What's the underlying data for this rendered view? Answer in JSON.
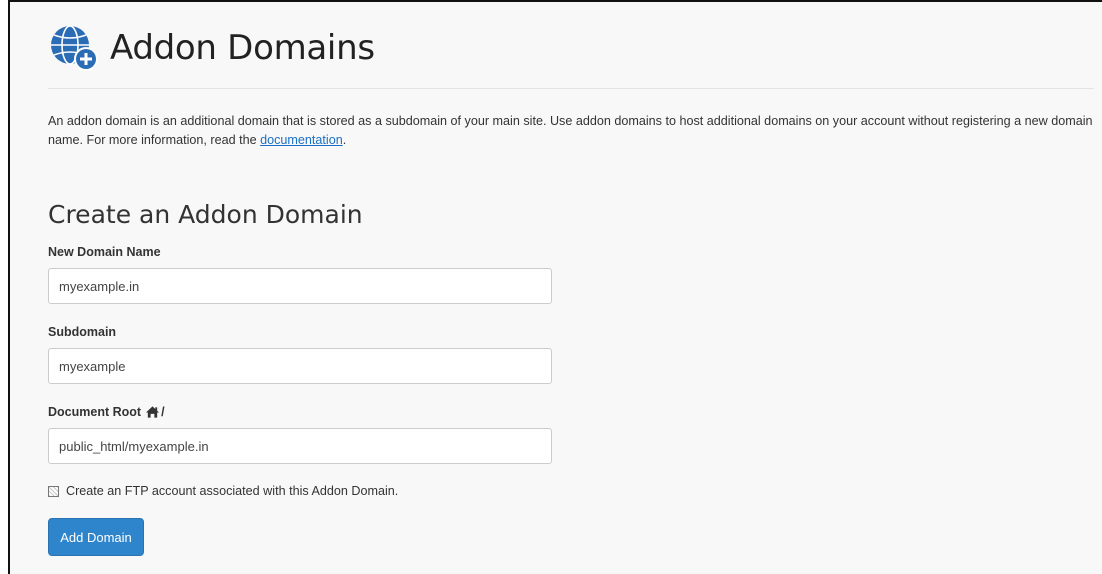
{
  "header": {
    "title": "Addon Domains",
    "icon": "globe-plus-icon"
  },
  "description": {
    "text_before_link": "An addon domain is an additional domain that is stored as a subdomain of your main site. Use addon domains to host additional domains on your account without registering a new domain name. For more information, read the ",
    "link_text": "documentation",
    "text_after_link": "."
  },
  "form": {
    "section_title": "Create an Addon Domain",
    "new_domain": {
      "label": "New Domain Name",
      "value": "myexample.in"
    },
    "subdomain": {
      "label": "Subdomain",
      "value": "myexample"
    },
    "document_root": {
      "label": "Document Root",
      "label_icon": "home-icon",
      "label_suffix": "/",
      "value": "public_html/myexample.in"
    },
    "ftp_checkbox": {
      "label": "Create an FTP account associated with this Addon Domain.",
      "checked": false
    },
    "submit_label": "Add Domain"
  },
  "colors": {
    "accent": "#2f85cc",
    "link": "#1a6fc4",
    "icon_blue": "#2a6db5"
  }
}
